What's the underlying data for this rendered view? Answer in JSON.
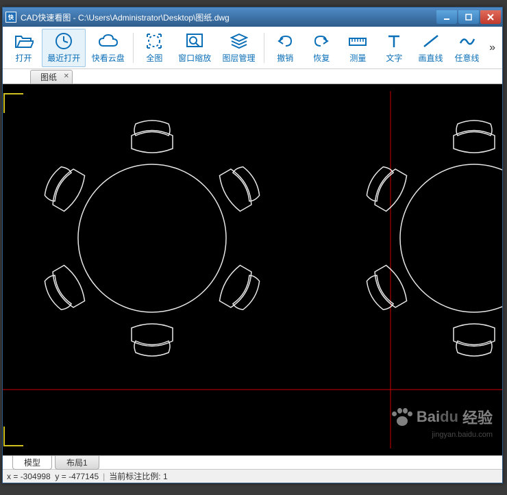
{
  "titlebar": {
    "app_icon_text": "快",
    "title": "CAD快速看图 - C:\\Users\\Administrator\\Desktop\\图纸.dwg"
  },
  "toolbar": {
    "open": "打开",
    "recent_open": "最近打开",
    "cloud_disk": "快看云盘",
    "full_view": "全图",
    "window_zoom": "窗口缩放",
    "layer_mgmt": "图层管理",
    "undo": "撤销",
    "redo": "恢复",
    "measure": "测量",
    "text": "文字",
    "draw_line": "画直线",
    "freehand": "任意线"
  },
  "doc_tab": {
    "label": "图纸"
  },
  "model_tabs": {
    "model": "模型",
    "layout1": "布局1"
  },
  "statusbar": {
    "x_label": "x =",
    "x_value": "-304998",
    "y_label": "y =",
    "y_value": "-477145",
    "scale_label": "当前标注比例:",
    "scale_value": "1"
  },
  "watermark": {
    "brand": "Bai",
    "brand2": "du",
    "suffix": "经验",
    "sub": "jingyan.baidu.com"
  },
  "colors": {
    "toolbar_blue": "#0b6fb8",
    "canvas_bg": "#000000",
    "crosshair_red": "#cc0000",
    "outline_white": "#e8e8e8",
    "corner_yellow": "#d0c020"
  }
}
